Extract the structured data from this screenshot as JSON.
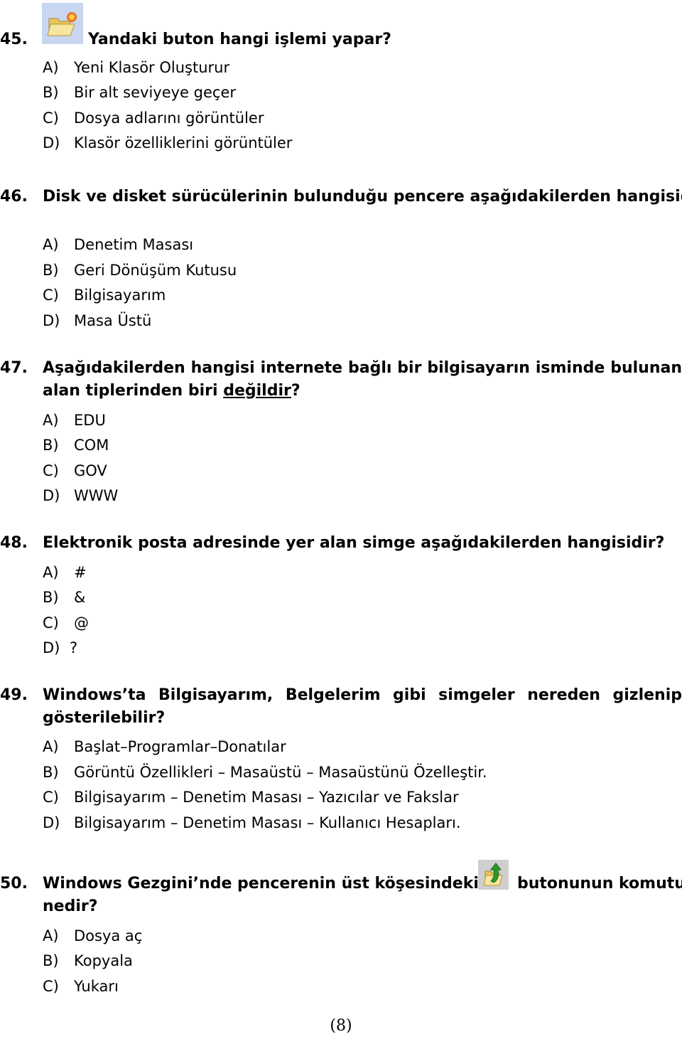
{
  "questions": [
    {
      "number": "45.",
      "text": "Yandaki buton hangi işlemi yapar?",
      "icon": "new-folder-icon",
      "options": [
        {
          "letter": "A)",
          "text": "Yeni Klasör Oluşturur"
        },
        {
          "letter": "B)",
          "text": "Bir alt seviyeye geçer"
        },
        {
          "letter": "C)",
          "text": "Dosya adlarını görüntüler"
        },
        {
          "letter": "D)",
          "text": "Klasör özelliklerini görüntüler"
        }
      ]
    },
    {
      "number": "46.",
      "text": "Disk ve disket sürücülerinin bulunduğu pencere aşağıdakilerden hangisidir?",
      "options": [
        {
          "letter": "A)",
          "text": "Denetim Masası"
        },
        {
          "letter": "B)",
          "text": "Geri Dönüşüm Kutusu"
        },
        {
          "letter": "C)",
          "text": "Bilgisayarım"
        },
        {
          "letter": "D)",
          "text": "Masa Üstü"
        }
      ]
    },
    {
      "number": "47.",
      "text_line1": "Aşağıdakilerden hangisi internete bağlı bir bilgisayarın isminde bulunan",
      "text_line2_pre": "alan tiplerinden biri ",
      "text_line2_underlined": "değildir",
      "text_line2_post": "?",
      "options": [
        {
          "letter": "A)",
          "text": "EDU"
        },
        {
          "letter": "B)",
          "text": "COM"
        },
        {
          "letter": "C)",
          "text": "GOV"
        },
        {
          "letter": "D)",
          "text": "WWW"
        }
      ]
    },
    {
      "number": "48.",
      "text": "Elektronik posta adresinde yer alan simge aşağıdakilerden hangisidir?",
      "options": [
        {
          "letter": "A)",
          "text": "#"
        },
        {
          "letter": "B)",
          "text": "&"
        },
        {
          "letter": "C)",
          "text": "@"
        },
        {
          "letter": "D)",
          "text": "?"
        }
      ]
    },
    {
      "number": "49.",
      "text_line1": "Windows’ta Bilgisayarım, Belgelerim gibi simgeler nereden gizlenip",
      "text_line2": "gösterilebilir?",
      "options": [
        {
          "letter": "A)",
          "text": "Başlat–Programlar–Donatılar"
        },
        {
          "letter": "B)",
          "text": "Görüntü Özellikleri – Masaüstü – Masaüstünü Özelleştir."
        },
        {
          "letter": "C)",
          "text": "Bilgisayarım – Denetim Masası – Yazıcılar ve Fakslar"
        },
        {
          "letter": "D)",
          "text": "Bilgisayarım – Denetim Masası – Kullanıcı Hesapları."
        }
      ]
    },
    {
      "number": "50.",
      "text_line1_pre": "Windows Gezgini’nde pencerenin üst köşesindeki",
      "icon": "up-folder-icon",
      "text_line1_post": "butonunun komutu",
      "text_line2": "nedir?",
      "options": [
        {
          "letter": "A)",
          "text": "Dosya aç"
        },
        {
          "letter": "B)",
          "text": "Kopyala"
        },
        {
          "letter": "C)",
          "text": "Yukarı"
        }
      ]
    }
  ],
  "page_number": "(8)"
}
